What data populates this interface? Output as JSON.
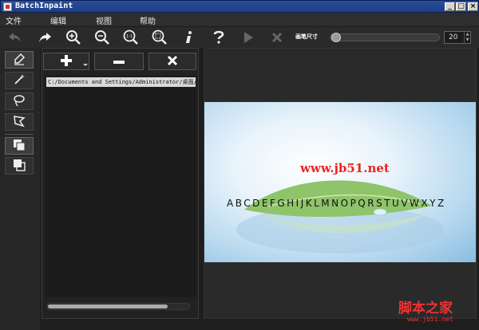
{
  "window": {
    "title": "BatchInpaint"
  },
  "menu": {
    "file": "文件",
    "edit": "编辑",
    "view": "视图",
    "help": "帮助"
  },
  "toolbar": {
    "icons": [
      "undo-icon",
      "redo-icon",
      "zoom-in-icon",
      "zoom-out-icon",
      "zoom-actual-icon",
      "zoom-fit-icon",
      "info-icon",
      "help-icon",
      "play-icon",
      "stop-icon"
    ],
    "brush_label": "画笔尺寸",
    "brush_size": "20",
    "brush_size_fraction": 0.0
  },
  "tools": [
    "marker-icon",
    "magic-wand-icon",
    "lasso-icon",
    "polygon-lasso-icon",
    "copy-front-icon",
    "copy-back-icon"
  ],
  "file_panel": {
    "files": [
      "C:/Documents and Settings/Administrator/桌面/f"
    ]
  },
  "preview": {
    "watermark_url": "www.jb51.net",
    "alphabet": "ABCDEFGHIJKLMNOPQRSTUVWXYZ"
  },
  "footer": {
    "logo": "脚本之家",
    "url": "www.jb51.net"
  },
  "colors": {
    "background": "#1e1e1e",
    "titlebar": "#1d3d86",
    "watermark": "#e22222"
  }
}
